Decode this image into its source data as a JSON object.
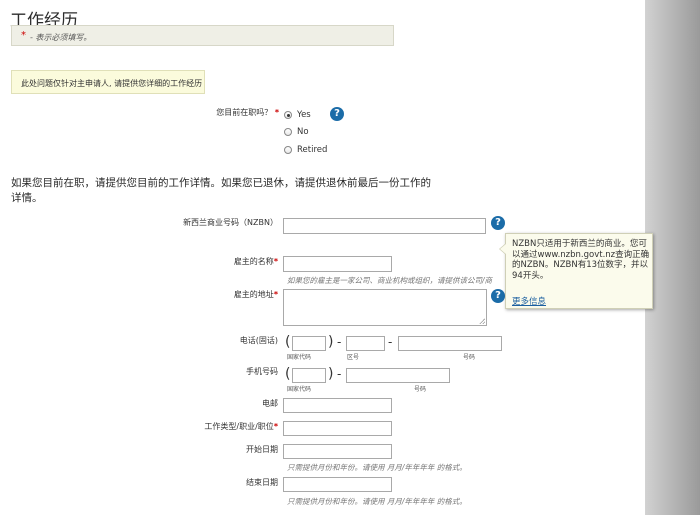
{
  "page": {
    "title": "工作经历"
  },
  "required_note": {
    "star": "*",
    "text": "- 表示必须填写。"
  },
  "info_note": {
    "text": "此处问题仅针对主申请人, 请提供您详细的工作经历"
  },
  "employment": {
    "question": "您目前在职吗？",
    "options": [
      "Yes",
      "No",
      "Retired"
    ],
    "selected": "Yes"
  },
  "instructions": "如果您目前在职，请提供您目前的工作详情。如果您已退休，请提供退休前最后一份工作的详情。",
  "fields": {
    "nzbn": {
      "label": "新西兰商业号码（NZBN）",
      "value": ""
    },
    "employer_name": {
      "label": "雇主的名称",
      "value": "",
      "hint": "如果您的雇主是一家公司、商业机构或组织，请提供该公司/商"
    },
    "employer_address": {
      "label": "雇主的地址",
      "value": ""
    },
    "landline": {
      "label": "电话(固话)",
      "country_code_label": "国家代码",
      "area_code_label": "区号",
      "number_label": "号码"
    },
    "mobile": {
      "label": "手机号码",
      "country_code_label": "国家代码",
      "number_label": "号码"
    },
    "email": {
      "label": "电邮",
      "value": ""
    },
    "job_title": {
      "label": "工作类型/职业/职位",
      "value": ""
    },
    "start_date": {
      "label": "开始日期",
      "value": "",
      "hint": "只需提供月份和年份。请使用 月月/年年年年 的格式。"
    },
    "end_date": {
      "label": "结束日期",
      "value": "",
      "hint": "只需提供月份和年份。请使用 月月/年年年年 的格式。"
    }
  },
  "tooltip": {
    "text": "NZBN只适用于新西兰的商业。您可以通过www.nzbn.govt.nz查询正确的NZBN。NZBN有13位数字，并以 94开头。",
    "link": "更多信息"
  },
  "required_marker": "*",
  "help_glyph": "?",
  "icons": [
    "help-icon",
    "radio-button"
  ],
  "colors": {
    "accent": "#1b6ca8",
    "required": "#cc0000",
    "note_bg": "#fbfbdc",
    "tooltip_bg": "#fbfbec"
  }
}
